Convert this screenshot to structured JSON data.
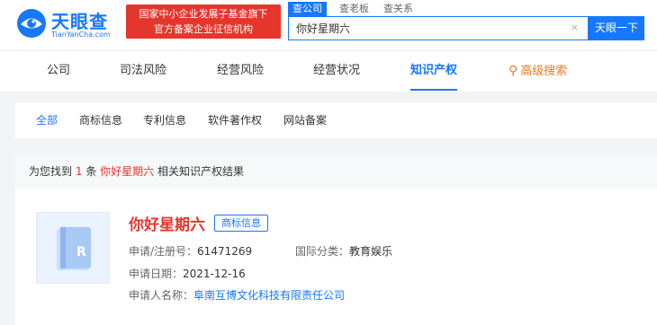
{
  "header": {
    "logo_text": "天眼查",
    "logo_sub": "TianYanCha.com",
    "badge_line1": "国家中小企业发展子基金旗下",
    "badge_line2": "官方备案企业征信机构",
    "search_tabs": [
      "查公司",
      "查老板",
      "查关系"
    ],
    "search_value": "你好星期六",
    "clear_glyph": "×",
    "search_button": "天眼一下"
  },
  "nav": {
    "items": [
      "公司",
      "司法风险",
      "经营风险",
      "经营状况",
      "知识产权"
    ],
    "advanced_glyph": "⚲",
    "advanced": "高级搜索"
  },
  "filter": {
    "tabs": [
      "全部",
      "商标信息",
      "专利信息",
      "软件著作权",
      "网站备案"
    ]
  },
  "count": {
    "prefix": "为您找到",
    "number": "1",
    "unit": "条",
    "keyword": "你好星期六",
    "suffix": "相关知识产权结果"
  },
  "result": {
    "title": "你好星期六",
    "tag": "商标信息",
    "reg_label": "申请/注册号：",
    "reg_value": "61471269",
    "class_label": "国际分类：",
    "class_value": "教育娱乐",
    "date_label": "申请日期：",
    "date_value": "2021-12-16",
    "applicant_label": "申请人名称：",
    "applicant_value": "阜南互博文化科技有限责任公司"
  },
  "colors": {
    "brand_blue": "#1677ff",
    "alert_red": "#e5362c",
    "advanced_orange": "#f07a25"
  }
}
